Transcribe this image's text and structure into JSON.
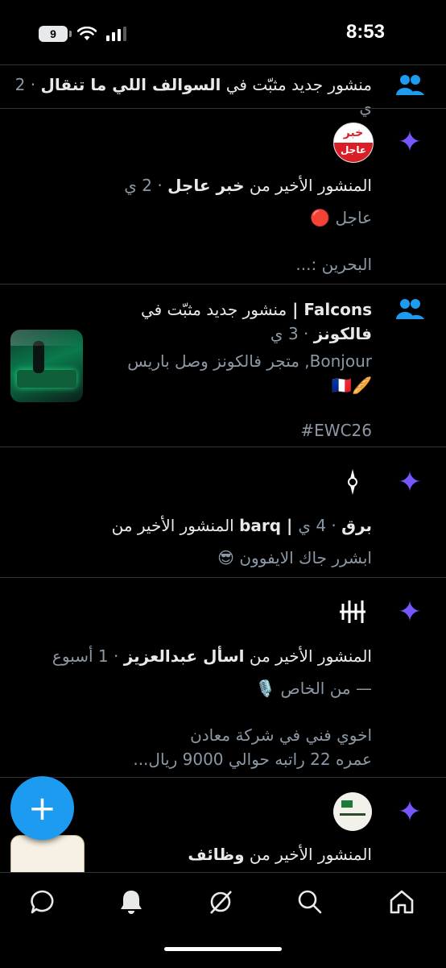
{
  "status_bar": {
    "time": "8:53",
    "battery": "9"
  },
  "notifications": [
    {
      "type_icon": "people-icon",
      "text_parts": [
        "منشور جديد مثبّت في ",
        "السوالف اللي ما تنقال",
        " · 2 ي"
      ]
    },
    {
      "type_icon": "sparkle-icon",
      "avatar_text": [
        "خبر",
        "عاجل"
      ],
      "title_parts": [
        "المنشور الأخير من ",
        "خبر عاجل",
        " · 2 ي"
      ],
      "body_line1": "عاجل 🔴",
      "body_line2": "البحرين :..."
    },
    {
      "type_icon": "people-icon",
      "title_line1_parts": [
        "Falcons | ",
        "منشور جديد مثبّت في"
      ],
      "title_line2_parts": [
        "فالكونز",
        " · 3 ي"
      ],
      "body_line1": "Bonjour, متجر فالكونز وصل باريس",
      "body_line2": "🥖🇫🇷",
      "body_line3": "#EWC26"
    },
    {
      "type_icon": "sparkle-icon",
      "title_parts": [
        "برق",
        " · 4 ي",
        " | barq",
        " المنشور الأخير من"
      ],
      "body_line1": "ابشرر جاك الايفوون 😎"
    },
    {
      "type_icon": "sparkle-icon",
      "title_parts": [
        "المنشور الأخير من ",
        "اسأل عبدالعزيز",
        " · 1 أسبوع"
      ],
      "body_line1": "— من الخاص 🎙️",
      "body_line2": "اخوي فني في شركة معادن",
      "body_line3": "عمره 22 راتبه حوالي 9000 ريال..."
    },
    {
      "type_icon": "sparkle-icon",
      "title_parts": [
        "المنشور الأخير من ",
        "وظائف"
      ]
    }
  ],
  "fab": {
    "label": "+"
  },
  "bottom_nav": [
    "messages-icon",
    "notifications-bell-icon",
    "grok-icon",
    "search-icon",
    "home-icon"
  ],
  "colors": {
    "accent": "#1d9bf0",
    "sparkle": "#7856ff",
    "background": "#000000",
    "divider": "#2f3336"
  }
}
